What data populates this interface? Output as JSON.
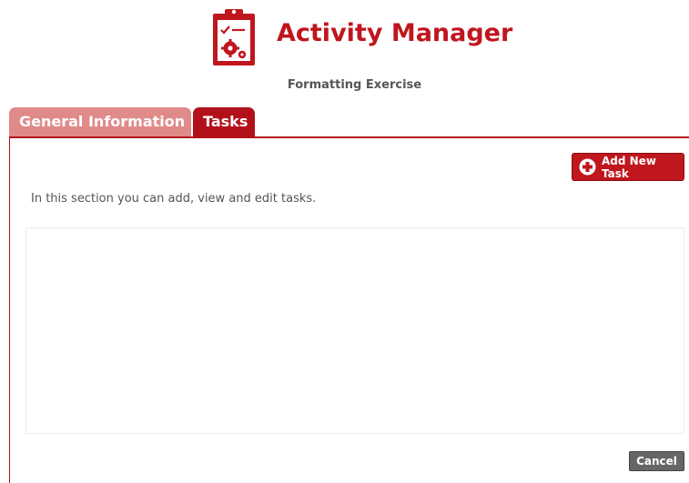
{
  "app": {
    "title": "Activity Manager",
    "subtitle": "Formatting Exercise",
    "logo_icon": "clipboard-gears-icon"
  },
  "tabs": [
    {
      "label": "General Information",
      "active": false
    },
    {
      "label": "Tasks",
      "active": true
    }
  ],
  "tasks_section": {
    "add_button_label": "Add New Task",
    "add_button_icon": "plus-circle-icon",
    "intro_text": "In this section you can add, view and edit tasks.",
    "tasks": []
  },
  "footer": {
    "cancel_label": "Cancel"
  },
  "colors": {
    "brand_red": "#c0161e",
    "tab_inactive": "#e18a8a",
    "tab_active": "#b3111a",
    "cancel_gray": "#666666"
  }
}
